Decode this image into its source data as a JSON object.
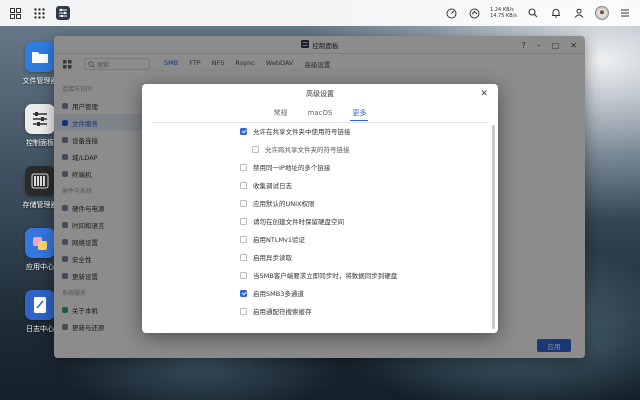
{
  "taskbar": {
    "upload_speed": "1.24 KB/s",
    "download_speed": "14.75 KB/s"
  },
  "desktop": {
    "icons": [
      {
        "label": "文件管理器",
        "color": "#2f7de1"
      },
      {
        "label": "控制面板",
        "color": "#e8e8e8"
      },
      {
        "label": "存储管理器",
        "color": "#2b2b2b"
      },
      {
        "label": "应用中心",
        "color": "#3477e0"
      },
      {
        "label": "日志中心",
        "color": "#2f63c8"
      }
    ]
  },
  "control_panel": {
    "title": "控制面板",
    "search_placeholder": "搜索",
    "tabs": [
      "SMB",
      "FTP",
      "NFS",
      "Rsync",
      "WebDAV",
      "高级设置"
    ],
    "sidebar": {
      "group1": "连接与访问",
      "items1": [
        "用户管理",
        "文件服务",
        "设备连接",
        "域/LDAP",
        "终端机"
      ],
      "group2": "硬件与系统",
      "items2": [
        "硬件与电源",
        "时间和语言",
        "网络设置",
        "安全性",
        "更新设置"
      ],
      "group3": "系统服务",
      "items3": [
        "关于本机",
        "更新与还原"
      ]
    },
    "apply_label": "应用"
  },
  "dialog": {
    "title": "高级设置",
    "tabs": [
      "常规",
      "macOS",
      "更多"
    ],
    "options": [
      {
        "label": "允许在共享文件夹中使用符号链接",
        "checked": true
      },
      {
        "label": "允许跨共享文件夹的符号链接",
        "checked": false
      },
      {
        "label": "禁用同一IP地址的多个链接",
        "checked": false
      },
      {
        "label": "收集调试日志",
        "checked": false
      },
      {
        "label": "应用默认的UNIX权限",
        "checked": false
      },
      {
        "label": "请勿在创建文件时保留硬盘空间",
        "checked": false
      },
      {
        "label": "启用NTLMv1验证",
        "checked": false
      },
      {
        "label": "启用异步读取",
        "checked": false
      },
      {
        "label": "当SMB客户端要求立即同步时，将数据同步到硬盘",
        "checked": false
      },
      {
        "label": "启用SMB3多通道",
        "checked": true
      },
      {
        "label": "启用通配符搜索缓存",
        "checked": false
      }
    ]
  }
}
